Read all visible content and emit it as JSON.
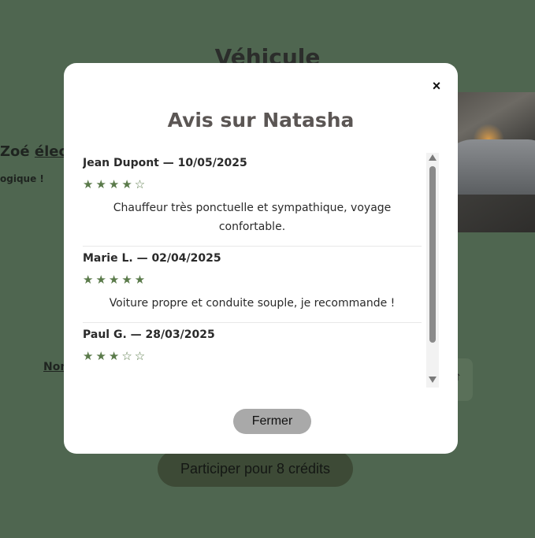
{
  "background": {
    "section_title": "Véhicule",
    "model_prefix": "Zoé ",
    "model_suffix": "électr",
    "eco_label": "ogique !",
    "name_label": "Nom",
    "box_arrow": "↑",
    "participate_label": "Participer pour 8 crédits"
  },
  "modal": {
    "close_label": "×",
    "title": "Avis sur Natasha",
    "reviews": [
      {
        "author": "Jean Dupont — 10/05/2025",
        "rating": 4,
        "stars": "★★★★☆",
        "text": "Chauffeur très ponctuelle et sympathique, voyage confortable."
      },
      {
        "author": "Marie L. — 02/04/2025",
        "rating": 5,
        "stars": "★★★★★",
        "text": "Voiture propre et conduite souple, je recommande !"
      },
      {
        "author": "Paul G. — 28/03/2025",
        "rating": 3,
        "stars": "★★★☆☆",
        "text": ""
      }
    ],
    "close_button_label": "Fermer"
  },
  "colors": {
    "page_background": "#4f6650",
    "star_color": "#5a7a4a",
    "participate_button": "#3d4a36",
    "fermer_button": "#a9a9a9"
  }
}
